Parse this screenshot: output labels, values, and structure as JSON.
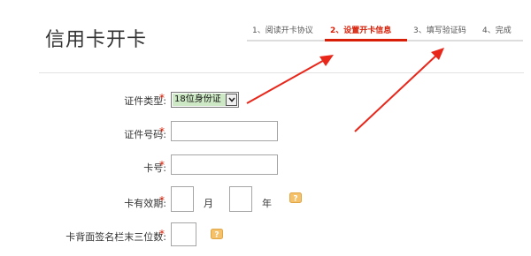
{
  "header": {
    "title": "信用卡开卡"
  },
  "steps": [
    {
      "label": "1、阅读开卡协议",
      "active": false
    },
    {
      "label": "2、设置开卡信息",
      "active": true
    },
    {
      "label": "3、填写验证码",
      "active": false
    },
    {
      "label": "4、完成",
      "active": false
    }
  ],
  "form": {
    "required_mark": "*",
    "id_type": {
      "label": "证件类型:",
      "selected": "18位身份证"
    },
    "id_number": {
      "label": "证件号码:",
      "value": ""
    },
    "card_number": {
      "label": "卡号:",
      "value": ""
    },
    "expiry": {
      "label": "卡有效期:",
      "month_unit": "月",
      "year_unit": "年",
      "month_value": "",
      "year_value": ""
    },
    "cvv": {
      "label": "卡背面签名栏末三位数:",
      "value": ""
    }
  },
  "icons": {
    "help": "help-icon",
    "dropdown": "chevron-down-icon"
  },
  "colors": {
    "accent": "#d81e06",
    "select_highlight": "#cde8c4",
    "help_icon": "#f5c26b",
    "annotation_arrow": "#e8261a"
  }
}
